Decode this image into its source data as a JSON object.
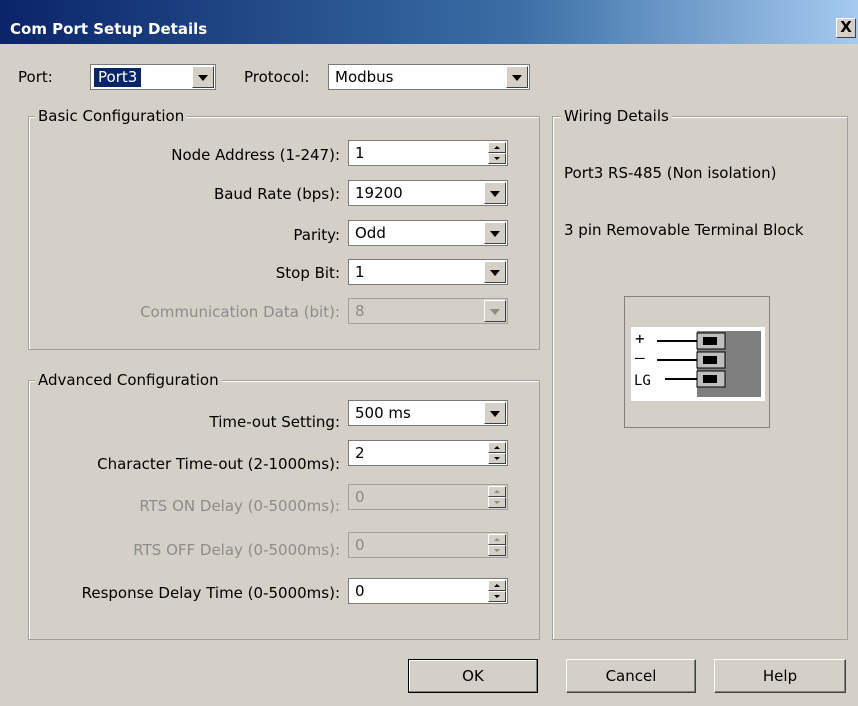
{
  "window": {
    "title": "Com Port Setup Details",
    "close_glyph": "X"
  },
  "top": {
    "port_label": "Port:",
    "port_value": "Port3",
    "protocol_label": "Protocol:",
    "protocol_value": "Modbus"
  },
  "basic": {
    "title": "Basic Configuration",
    "node_address_label": "Node Address (1-247):",
    "node_address_value": "1",
    "baud_rate_label": "Baud Rate (bps):",
    "baud_rate_value": "19200",
    "parity_label": "Parity:",
    "parity_value": "Odd",
    "stop_bit_label": "Stop Bit:",
    "stop_bit_value": "1",
    "comm_data_label": "Communication Data (bit):",
    "comm_data_value": "8"
  },
  "advanced": {
    "title": "Advanced Configuration",
    "timeout_label": "Time-out Setting:",
    "timeout_value": "500 ms",
    "char_timeout_label": "Character Time-out (2-1000ms):",
    "char_timeout_value": "2",
    "rts_on_label": "RTS ON Delay (0-5000ms):",
    "rts_on_value": "0",
    "rts_off_label": "RTS OFF Delay (0-5000ms):",
    "rts_off_value": "0",
    "response_delay_label": "Response Delay Time (0-5000ms):",
    "response_delay_value": "0"
  },
  "wiring": {
    "title": "Wiring Details",
    "line1": "Port3 RS-485 (Non isolation)",
    "line2": "3 pin Removable Terminal Block",
    "terminal_labels": [
      "+",
      "–",
      "LG"
    ]
  },
  "buttons": {
    "ok": "OK",
    "cancel": "Cancel",
    "help": "Help"
  },
  "colors": {
    "title_start": "#0a246a",
    "title_end": "#a6caf0",
    "face": "#d4d0c8"
  }
}
